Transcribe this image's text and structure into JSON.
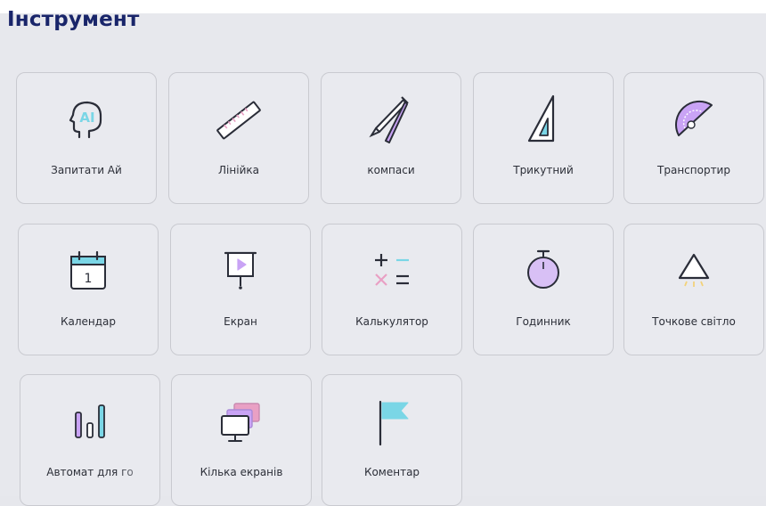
{
  "section_title": "Інструмент",
  "tools": [
    {
      "label": "Запитати Ай",
      "icon": "ai-head-icon"
    },
    {
      "label": "Лінійка",
      "icon": "ruler-icon"
    },
    {
      "label": "компаси",
      "icon": "compass-icon"
    },
    {
      "label": "Трикутний",
      "icon": "triangle-ruler-icon"
    },
    {
      "label": "Транспортир",
      "icon": "protractor-icon"
    },
    {
      "label": "Календар",
      "icon": "calendar-icon"
    },
    {
      "label": "Екран",
      "icon": "projector-screen-icon"
    },
    {
      "label": "Калькулятор",
      "icon": "calculator-icon"
    },
    {
      "label": "Годинник",
      "icon": "stopwatch-icon"
    },
    {
      "label": "Точкове світло",
      "icon": "spotlight-icon"
    },
    {
      "label": "Автомат для го",
      "icon": "bar-chart-icon"
    },
    {
      "label": "Кілька екранів",
      "icon": "multi-screen-icon"
    },
    {
      "label": "Коментар",
      "icon": "flag-icon"
    }
  ],
  "icon_text": {
    "ai": "AI",
    "calendar_day": "1"
  },
  "colors": {
    "title": "#19256a",
    "icon_stroke": "#2a2d38",
    "accent_purple": "#c9a3f5",
    "accent_teal": "#7ad6e6",
    "accent_pink": "#e9a0c4",
    "tile_border": "#c9cad0"
  }
}
